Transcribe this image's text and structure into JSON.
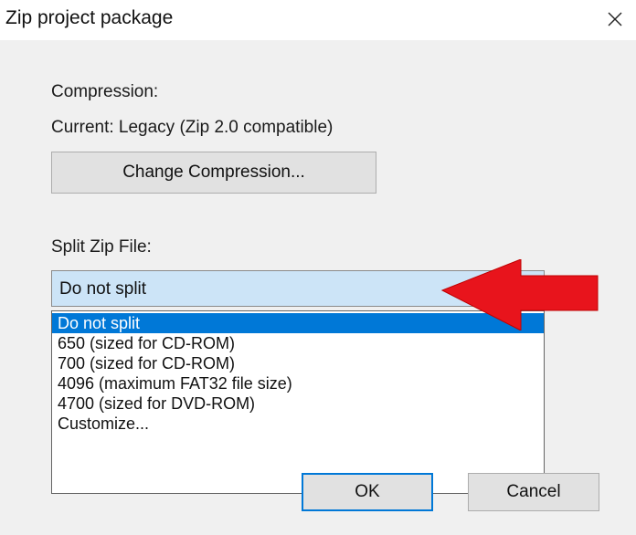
{
  "window": {
    "title": "Zip project package",
    "close_icon": "close-icon"
  },
  "compression": {
    "label": "Compression:",
    "current": "Current: Legacy (Zip 2.0 compatible)",
    "change_button_label": "Change Compression..."
  },
  "split": {
    "label": "Split Zip File:",
    "selected_value": "Do not split",
    "options": [
      "Do not split",
      "650 (sized for CD-ROM)",
      "700 (sized for CD-ROM)",
      "4096 (maximum FAT32 file size)",
      "4700 (sized for DVD-ROM)",
      "Customize..."
    ],
    "selected_index": 0
  },
  "buttons": {
    "ok_label": "OK",
    "cancel_label": "Cancel"
  },
  "annotation": {
    "arrow_icon": "red-arrow-icon",
    "arrow_color": "#e8141c"
  },
  "colors": {
    "accent": "#0078d7",
    "combo_background": "#cce4f7",
    "dialog_background": "#f0f0f0"
  }
}
